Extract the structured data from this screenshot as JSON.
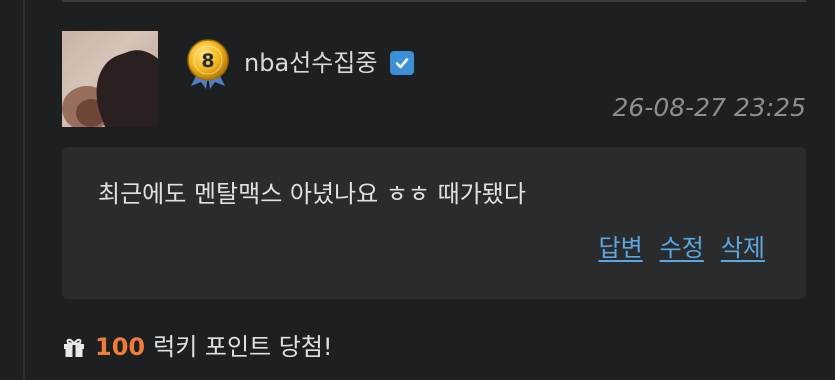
{
  "comment": {
    "author": {
      "name": "nba선수집중",
      "level": "8",
      "level_badge_icon": "level-8-badge-icon",
      "verified_icon": "checkbox-check-icon"
    },
    "timestamp": "26-08-27 23:25",
    "body": "최근에도 멘탈맥스 아녔나요 ㅎㅎ 때가됐다",
    "actions": {
      "reply": "답변",
      "edit": "수정",
      "delete": "삭제"
    }
  },
  "lucky_point": {
    "icon": "gift-icon",
    "amount": "100",
    "text": "럭키 포인트 당첨!"
  },
  "colors": {
    "background": "#1e1f20",
    "comment_box": "#2a2b2d",
    "link": "#5ba7e0",
    "points": "#f07c3a",
    "verified": "#3d8fd6"
  }
}
